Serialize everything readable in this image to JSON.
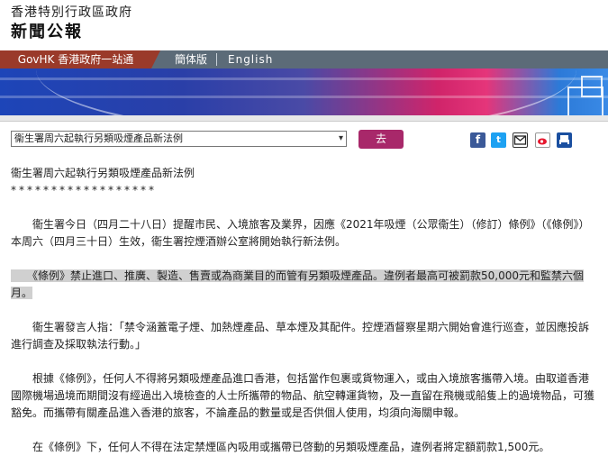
{
  "header": {
    "gov_name": "香港特別行政區政府",
    "site_name": "新聞公報"
  },
  "nav": {
    "govhk": "GovHK 香港政府一站通",
    "simplified": "簡体版",
    "english": "English"
  },
  "toolbar": {
    "select_value": "衞生署周六起執行另類吸煙產品新法例",
    "go_label": "去"
  },
  "share_icons": [
    "facebook-icon",
    "twitter-icon",
    "email-icon",
    "weibo-icon",
    "print-icon"
  ],
  "colors": {
    "brand": "#a8286a",
    "govhk_tab": "#9a3a2a",
    "nav_bg": "#5c6b78"
  },
  "article": {
    "title": "衞生署周六起執行另類吸煙產品新法例",
    "stars": "******************",
    "paragraphs": [
      "　　衞生署今日（四月二十八日）提醒市民、入境旅客及業界，因應《2021年吸煙（公眾衞生）（修訂）條例》（《條例》）本周六（四月三十日）生效，衞生署控煙酒辦公室將開始執行新法例。",
      "　　《條例》禁止進口、推廣、製造、售賣或為商業目的而管有另類吸煙產品。違例者最高可被罰款50,000元和監禁六個月。",
      "　　衞生署發言人指：「禁令涵蓋電子煙、加熱煙產品、草本煙及其配件。控煙酒督察星期六開始會進行巡查，並因應投訴進行調查及採取執法行動。」",
      "　　根據《條例》，任何人不得將另類吸煙產品進口香港，包括當作包裹或貨物運入，或由入境旅客攜帶入境。由取道香港國際機場過境而期間沒有經過出入境檢查的人士所攜帶的物品、航空轉運貨物，及一直留在飛機或船隻上的過境物品，可獲豁免。而攜帶有關產品進入香港的旅客，不論產品的數量或是否供個人使用，均須向海關申報。",
      "　　在《條例》下，任何人不得在法定禁煙區內吸用或攜帶已啓動的另類吸煙產品，違例者將定額罰款1,500元。"
    ]
  }
}
